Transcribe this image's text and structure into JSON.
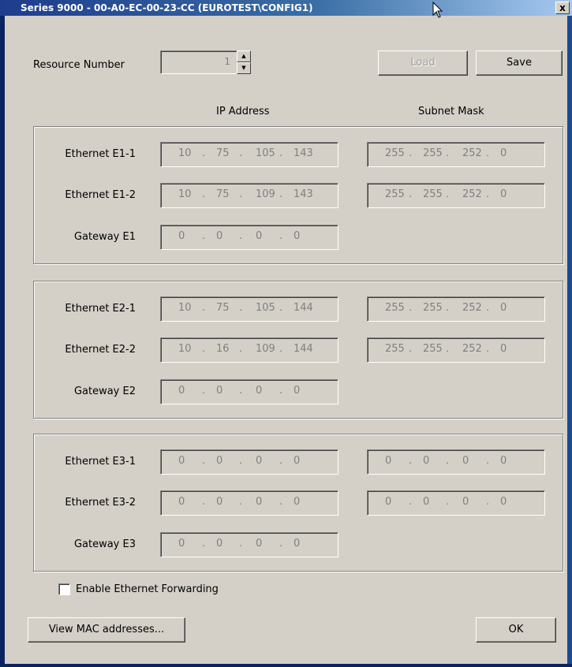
{
  "window": {
    "title": "Series 9000 - 00-A0-EC-00-23-CC (EUROTEST\\CONFIG1)",
    "close_label": "x"
  },
  "resource": {
    "label": "Resource Number",
    "value": "1"
  },
  "buttons": {
    "load": "Load",
    "save": "Save",
    "view_mac": "View MAC addresses...",
    "ok": "OK"
  },
  "headers": {
    "ip": "IP Address",
    "subnet": "Subnet Mask"
  },
  "groups": [
    {
      "rows": [
        {
          "label": "Ethernet E1-1",
          "ip": [
            "10",
            "75",
            "105",
            "143"
          ],
          "mask": [
            "255",
            "255",
            "252",
            "0"
          ]
        },
        {
          "label": "Ethernet E1-2",
          "ip": [
            "10",
            "75",
            "109",
            "143"
          ],
          "mask": [
            "255",
            "255",
            "252",
            "0"
          ]
        },
        {
          "label": "Gateway E1",
          "ip": [
            "0",
            "0",
            "0",
            "0"
          ]
        }
      ]
    },
    {
      "rows": [
        {
          "label": "Ethernet E2-1",
          "ip": [
            "10",
            "75",
            "105",
            "144"
          ],
          "mask": [
            "255",
            "255",
            "252",
            "0"
          ]
        },
        {
          "label": "Ethernet E2-2",
          "ip": [
            "10",
            "16",
            "109",
            "144"
          ],
          "mask": [
            "255",
            "255",
            "252",
            "0"
          ]
        },
        {
          "label": "Gateway E2",
          "ip": [
            "0",
            "0",
            "0",
            "0"
          ]
        }
      ]
    },
    {
      "rows": [
        {
          "label": "Ethernet E3-1",
          "ip": [
            "0",
            "0",
            "0",
            "0"
          ],
          "mask": [
            "0",
            "0",
            "0",
            "0"
          ]
        },
        {
          "label": "Ethernet E3-2",
          "ip": [
            "0",
            "0",
            "0",
            "0"
          ],
          "mask": [
            "0",
            "0",
            "0",
            "0"
          ]
        },
        {
          "label": "Gateway E3",
          "ip": [
            "0",
            "0",
            "0",
            "0"
          ]
        }
      ]
    }
  ],
  "forwarding": {
    "label": "Enable Ethernet Forwarding",
    "checked": false
  }
}
